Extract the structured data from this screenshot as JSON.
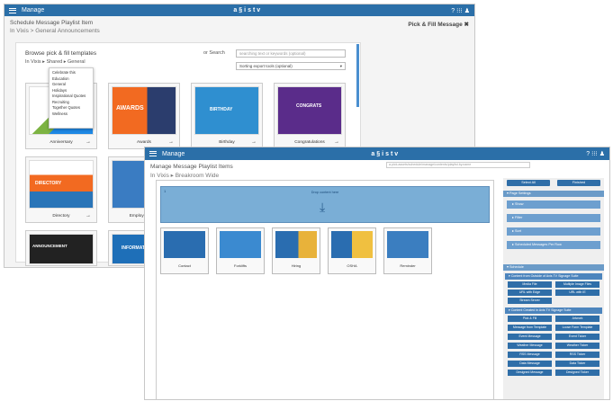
{
  "winA": {
    "menu": "Manage",
    "logo": "a§istv",
    "icons": "? ⁝⁝⁝ ♟",
    "subtitle": "Schedule Message Playlist Item",
    "crumb": "In Vixis > General Announcements",
    "pfm": "Pick & Fill Message ✖",
    "browse": "Browse pick & fill templates",
    "path": "In Vixis ▸ Shared ▸ General",
    "orsearch": "or Search",
    "search_placeholder": "searching text or keywords (optional)",
    "sort": "Sorting export tools (optional)",
    "dropdown": [
      "Celebrate this",
      "Education",
      "General",
      "Holidays",
      "Inspirational Quotes",
      "Recruiting",
      "Together Quotes",
      "Wellness"
    ],
    "cards": [
      {
        "label": "Anniversary",
        "thumb_text": ""
      },
      {
        "label": "Awards",
        "thumb_text": "AWARDS"
      },
      {
        "label": "Birthday",
        "thumb_text": "BIRTHDAY"
      },
      {
        "label": "Congratulations",
        "thumb_text": "CONGRATS"
      },
      {
        "label": "Directory",
        "thumb_text": "DIRECTORY"
      },
      {
        "label": "Employee Appr",
        "thumb_text": ""
      },
      {
        "label": "",
        "thumb_text": "ANNOUNCEMENT"
      },
      {
        "label": "",
        "thumb_text": "INFORMATION"
      }
    ]
  },
  "winB": {
    "menu": "Manage",
    "logo": "a§istv",
    "icons": "? ⁝⁝⁝ ♟",
    "subtitle": "Manage Message Playlist Items",
    "crumb": "In Vixis ▸ Breakroom Wide",
    "address": "a.pick.assets/schedule/manage/contents/playlist.by.name",
    "drop_text": "Drop content here",
    "drop_num": "1",
    "items": [
      "Contact",
      "Forklifts",
      "Hiring",
      "OSHA",
      "Reminder"
    ],
    "select_all": "Select All",
    "finished": "Finished",
    "page_settings": "Page Settings",
    "settings_rows": [
      "Show",
      "Filter",
      "Sort",
      "Scheduled Messages Per Row"
    ],
    "schedule": "Schedule",
    "content_outside": "Content from Outside of Axis TV Signage Suite",
    "outside_btns": [
      "Media File",
      "Multiple Image Files",
      "URL with Edge",
      "URL with IE",
      "Stream Server"
    ],
    "content_created": "Content Created in Axis TV Signage Suite",
    "created_btns": [
      "Pick & Fill",
      "Artwork",
      "Message from Template",
      "Loose Form Template",
      "Event Message",
      "Event Ticker",
      "Weather Message",
      "Weather Ticker",
      "RSS Message",
      "RSS Ticker",
      "Data Message",
      "Data Ticker",
      "Designed Message",
      "Designed Ticker"
    ]
  },
  "colors": {
    "accent": "#2b6fa8",
    "drop": "#7aaed6"
  }
}
